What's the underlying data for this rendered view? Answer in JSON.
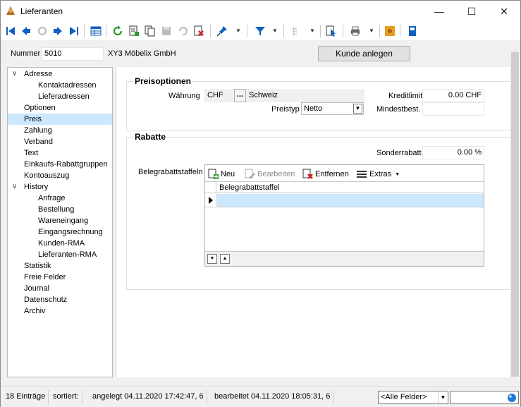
{
  "window": {
    "title": "Lieferanten",
    "minimize": "—",
    "maximize": "☐",
    "close": "✕"
  },
  "toolbar": {
    "icons": [
      "first-record-icon",
      "prev-record-icon",
      "refresh-disabled-icon",
      "next-record-icon",
      "last-record-icon",
      "table-view-icon",
      "refresh-icon",
      "new-record-icon",
      "copy-record-icon",
      "save-icon",
      "undo-icon",
      "delete-icon",
      "pin-icon",
      "filter-icon",
      "tree-icon",
      "cursor-help-icon",
      "print-icon",
      "addon-icon",
      "info-icon"
    ]
  },
  "header": {
    "nummer_label": "Nummer",
    "nummer_value": "5010",
    "name": "XY3 Möbelix GmbH",
    "kunde_anlegen": "Kunde anlegen"
  },
  "tree": {
    "items": [
      {
        "label": "Adresse",
        "level": 0,
        "expanded": true
      },
      {
        "label": "Kontaktadressen",
        "level": 2
      },
      {
        "label": "Lieferadressen",
        "level": 2
      },
      {
        "label": "Optionen",
        "level": 1
      },
      {
        "label": "Preis",
        "level": 1,
        "selected": true
      },
      {
        "label": "Zahlung",
        "level": 1
      },
      {
        "label": "Verband",
        "level": 1
      },
      {
        "label": "Text",
        "level": 1
      },
      {
        "label": "Einkaufs-Rabattgruppen",
        "level": 1
      },
      {
        "label": "Kontoauszug",
        "level": 1
      },
      {
        "label": "History",
        "level": 0,
        "expanded": true
      },
      {
        "label": "Anfrage",
        "level": 2
      },
      {
        "label": "Bestellung",
        "level": 2
      },
      {
        "label": "Wareneingang",
        "level": 2
      },
      {
        "label": "Eingangsrechnung",
        "level": 2
      },
      {
        "label": "Kunden-RMA",
        "level": 2
      },
      {
        "label": "Lieferanten-RMA",
        "level": 2
      },
      {
        "label": "Statistik",
        "level": 1
      },
      {
        "label": "Freie Felder",
        "level": 1
      },
      {
        "label": "Journal",
        "level": 1
      },
      {
        "label": "Datenschutz",
        "level": 1
      },
      {
        "label": "Archiv",
        "level": 1
      }
    ]
  },
  "preisoptionen": {
    "title": "Preisoptionen",
    "waehrung_label": "Währung",
    "waehrung_value": "CHF",
    "waehrung_button": "...",
    "waehrung_name": "Schweiz",
    "preistyp_label": "Preistyp",
    "preistyp_value": "Netto",
    "kreditlimit_label": "Kreditlimit",
    "kreditlimit_value": "0.00 CHF",
    "mindestbest_label": "Mindestbest.",
    "mindestbest_value": ""
  },
  "rabatte": {
    "title": "Rabatte",
    "sonderrabatt_label": "Sonderrabatt",
    "sonderrabatt_value": "0.00 %",
    "belegrabatt_label": "Belegrabattstaffeln",
    "grid_toolbar": {
      "neu": "Neu",
      "bearbeiten": "Bearbeiten",
      "entfernen": "Entfernen",
      "extras": "Extras"
    },
    "grid_column": "Belegrabattstaffel"
  },
  "statusbar": {
    "count": "18 Einträge",
    "sortiert": "sortiert:",
    "angelegt": "angelegt 04.11.2020 17:42:47,  6",
    "bearbeitet": "bearbeitet 04.11.2020 18:05:31,  6",
    "filter_value": "<Alle Felder>",
    "search_value": ""
  },
  "colors": {
    "accent": "#0a64c8",
    "selection": "#cce8ff"
  }
}
